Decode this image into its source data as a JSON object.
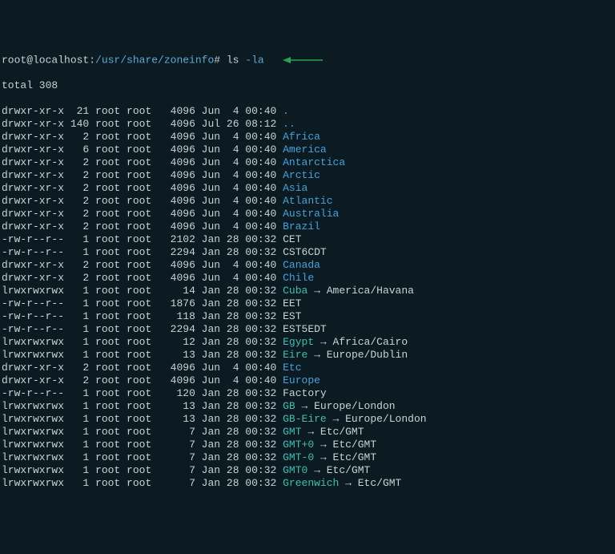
{
  "prompt": {
    "host": "root@localhost:",
    "path": "/usr/share/zoneinfo",
    "end": "# ",
    "cmd_prefix": "ls ",
    "cmd_opt": "-la"
  },
  "total_line": "total 308",
  "rows": [
    {
      "perm": "drwxr-xr-x",
      "links": " 21",
      "owner": "root",
      "group": "root",
      "size": "  4096",
      "month": "Jun",
      "day": " 4",
      "time": "00:40",
      "name": ".",
      "type": "dir"
    },
    {
      "perm": "drwxr-xr-x",
      "links": "140",
      "owner": "root",
      "group": "root",
      "size": "  4096",
      "month": "Jul",
      "day": "26",
      "time": "08:12",
      "name": "..",
      "type": "dir"
    },
    {
      "perm": "drwxr-xr-x",
      "links": "  2",
      "owner": "root",
      "group": "root",
      "size": "  4096",
      "month": "Jun",
      "day": " 4",
      "time": "00:40",
      "name": "Africa",
      "type": "dir"
    },
    {
      "perm": "drwxr-xr-x",
      "links": "  6",
      "owner": "root",
      "group": "root",
      "size": "  4096",
      "month": "Jun",
      "day": " 4",
      "time": "00:40",
      "name": "America",
      "type": "dir"
    },
    {
      "perm": "drwxr-xr-x",
      "links": "  2",
      "owner": "root",
      "group": "root",
      "size": "  4096",
      "month": "Jun",
      "day": " 4",
      "time": "00:40",
      "name": "Antarctica",
      "type": "dir"
    },
    {
      "perm": "drwxr-xr-x",
      "links": "  2",
      "owner": "root",
      "group": "root",
      "size": "  4096",
      "month": "Jun",
      "day": " 4",
      "time": "00:40",
      "name": "Arctic",
      "type": "dir"
    },
    {
      "perm": "drwxr-xr-x",
      "links": "  2",
      "owner": "root",
      "group": "root",
      "size": "  4096",
      "month": "Jun",
      "day": " 4",
      "time": "00:40",
      "name": "Asia",
      "type": "dir"
    },
    {
      "perm": "drwxr-xr-x",
      "links": "  2",
      "owner": "root",
      "group": "root",
      "size": "  4096",
      "month": "Jun",
      "day": " 4",
      "time": "00:40",
      "name": "Atlantic",
      "type": "dir"
    },
    {
      "perm": "drwxr-xr-x",
      "links": "  2",
      "owner": "root",
      "group": "root",
      "size": "  4096",
      "month": "Jun",
      "day": " 4",
      "time": "00:40",
      "name": "Australia",
      "type": "dir"
    },
    {
      "perm": "drwxr-xr-x",
      "links": "  2",
      "owner": "root",
      "group": "root",
      "size": "  4096",
      "month": "Jun",
      "day": " 4",
      "time": "00:40",
      "name": "Brazil",
      "type": "dir"
    },
    {
      "perm": "-rw-r--r--",
      "links": "  1",
      "owner": "root",
      "group": "root",
      "size": "  2102",
      "month": "Jan",
      "day": "28",
      "time": "00:32",
      "name": "CET",
      "type": "file"
    },
    {
      "perm": "-rw-r--r--",
      "links": "  1",
      "owner": "root",
      "group": "root",
      "size": "  2294",
      "month": "Jan",
      "day": "28",
      "time": "00:32",
      "name": "CST6CDT",
      "type": "file"
    },
    {
      "perm": "drwxr-xr-x",
      "links": "  2",
      "owner": "root",
      "group": "root",
      "size": "  4096",
      "month": "Jun",
      "day": " 4",
      "time": "00:40",
      "name": "Canada",
      "type": "dir"
    },
    {
      "perm": "drwxr-xr-x",
      "links": "  2",
      "owner": "root",
      "group": "root",
      "size": "  4096",
      "month": "Jun",
      "day": " 4",
      "time": "00:40",
      "name": "Chile",
      "type": "dir"
    },
    {
      "perm": "lrwxrwxrwx",
      "links": "  1",
      "owner": "root",
      "group": "root",
      "size": "    14",
      "month": "Jan",
      "day": "28",
      "time": "00:32",
      "name": "Cuba",
      "type": "link",
      "target": "America/Havana"
    },
    {
      "perm": "-rw-r--r--",
      "links": "  1",
      "owner": "root",
      "group": "root",
      "size": "  1876",
      "month": "Jan",
      "day": "28",
      "time": "00:32",
      "name": "EET",
      "type": "file"
    },
    {
      "perm": "-rw-r--r--",
      "links": "  1",
      "owner": "root",
      "group": "root",
      "size": "   118",
      "month": "Jan",
      "day": "28",
      "time": "00:32",
      "name": "EST",
      "type": "file"
    },
    {
      "perm": "-rw-r--r--",
      "links": "  1",
      "owner": "root",
      "group": "root",
      "size": "  2294",
      "month": "Jan",
      "day": "28",
      "time": "00:32",
      "name": "EST5EDT",
      "type": "file"
    },
    {
      "perm": "lrwxrwxrwx",
      "links": "  1",
      "owner": "root",
      "group": "root",
      "size": "    12",
      "month": "Jan",
      "day": "28",
      "time": "00:32",
      "name": "Egypt",
      "type": "link",
      "target": "Africa/Cairo"
    },
    {
      "perm": "lrwxrwxrwx",
      "links": "  1",
      "owner": "root",
      "group": "root",
      "size": "    13",
      "month": "Jan",
      "day": "28",
      "time": "00:32",
      "name": "Eire",
      "type": "link",
      "target": "Europe/Dublin"
    },
    {
      "perm": "drwxr-xr-x",
      "links": "  2",
      "owner": "root",
      "group": "root",
      "size": "  4096",
      "month": "Jun",
      "day": " 4",
      "time": "00:40",
      "name": "Etc",
      "type": "dir"
    },
    {
      "perm": "drwxr-xr-x",
      "links": "  2",
      "owner": "root",
      "group": "root",
      "size": "  4096",
      "month": "Jun",
      "day": " 4",
      "time": "00:40",
      "name": "Europe",
      "type": "dir"
    },
    {
      "perm": "-rw-r--r--",
      "links": "  1",
      "owner": "root",
      "group": "root",
      "size": "   120",
      "month": "Jan",
      "day": "28",
      "time": "00:32",
      "name": "Factory",
      "type": "file"
    },
    {
      "perm": "lrwxrwxrwx",
      "links": "  1",
      "owner": "root",
      "group": "root",
      "size": "    13",
      "month": "Jan",
      "day": "28",
      "time": "00:32",
      "name": "GB",
      "type": "link",
      "target": "Europe/London"
    },
    {
      "perm": "lrwxrwxrwx",
      "links": "  1",
      "owner": "root",
      "group": "root",
      "size": "    13",
      "month": "Jan",
      "day": "28",
      "time": "00:32",
      "name": "GB-Eire",
      "type": "link",
      "target": "Europe/London"
    },
    {
      "perm": "lrwxrwxrwx",
      "links": "  1",
      "owner": "root",
      "group": "root",
      "size": "     7",
      "month": "Jan",
      "day": "28",
      "time": "00:32",
      "name": "GMT",
      "type": "link",
      "target": "Etc/GMT"
    },
    {
      "perm": "lrwxrwxrwx",
      "links": "  1",
      "owner": "root",
      "group": "root",
      "size": "     7",
      "month": "Jan",
      "day": "28",
      "time": "00:32",
      "name": "GMT+0",
      "type": "link",
      "target": "Etc/GMT"
    },
    {
      "perm": "lrwxrwxrwx",
      "links": "  1",
      "owner": "root",
      "group": "root",
      "size": "     7",
      "month": "Jan",
      "day": "28",
      "time": "00:32",
      "name": "GMT-0",
      "type": "link",
      "target": "Etc/GMT"
    },
    {
      "perm": "lrwxrwxrwx",
      "links": "  1",
      "owner": "root",
      "group": "root",
      "size": "     7",
      "month": "Jan",
      "day": "28",
      "time": "00:32",
      "name": "GMT0",
      "type": "link",
      "target": "Etc/GMT"
    },
    {
      "perm": "lrwxrwxrwx",
      "links": "  1",
      "owner": "root",
      "group": "root",
      "size": "     7",
      "month": "Jan",
      "day": "28",
      "time": "00:32",
      "name": "Greenwich",
      "type": "link",
      "target": "Etc/GMT"
    }
  ]
}
